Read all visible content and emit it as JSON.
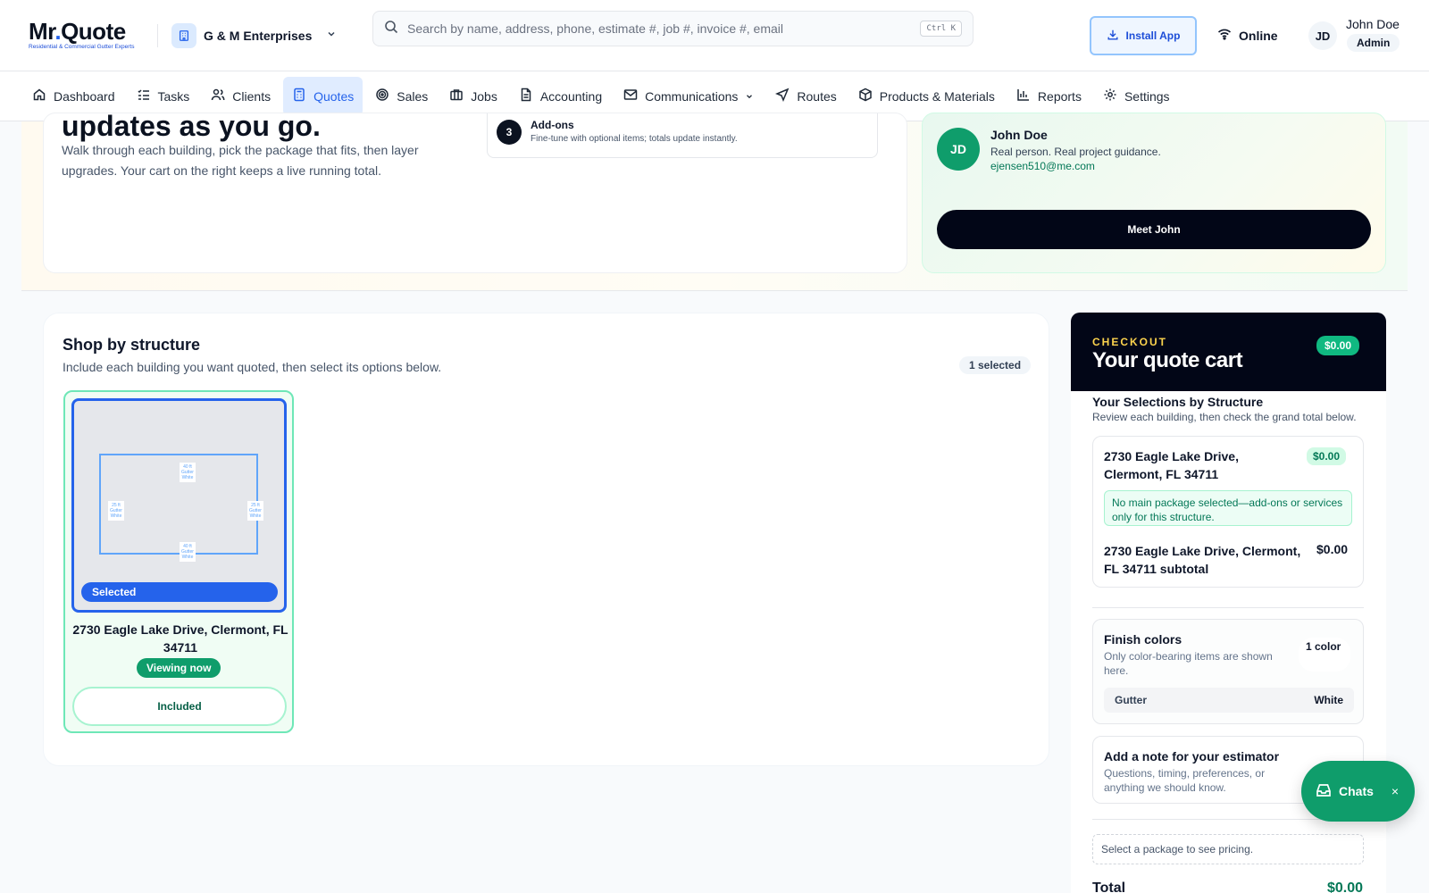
{
  "brand": {
    "name": "Mr.Quote",
    "name_main": "Mr",
    "name_dot": ".",
    "name_rest": "Quote",
    "tagline": "Residential & Commercial Gutter Experts",
    "accent": "#2563eb"
  },
  "company": {
    "name": "G & M Enterprises"
  },
  "search": {
    "placeholder": "Search by name, address, phone, estimate #, job #, invoice #, email",
    "shortcut": "Ctrl K"
  },
  "header": {
    "install_label": "Install App",
    "status": "Online",
    "user_initials": "JD",
    "user_name": "John Doe",
    "user_role": "Admin"
  },
  "nav": [
    {
      "label": "Dashboard",
      "icon": "home-icon"
    },
    {
      "label": "Tasks",
      "icon": "list-icon"
    },
    {
      "label": "Clients",
      "icon": "users-icon"
    },
    {
      "label": "Quotes",
      "icon": "calculator-icon",
      "active": true
    },
    {
      "label": "Sales",
      "icon": "target-icon"
    },
    {
      "label": "Jobs",
      "icon": "briefcase-icon"
    },
    {
      "label": "Accounting",
      "icon": "file-icon"
    },
    {
      "label": "Communications",
      "icon": "mail-icon",
      "has_dropdown": true
    },
    {
      "label": "Routes",
      "icon": "navigation-icon"
    },
    {
      "label": "Products & Materials",
      "icon": "box-icon"
    },
    {
      "label": "Reports",
      "icon": "bar-chart-icon"
    },
    {
      "label": "Settings",
      "icon": "gear-icon"
    }
  ],
  "hero": {
    "title_partial": "updates as you go.",
    "description": "Walk through each building, pick the package that fits, then layer upgrades. Your cart on the right keeps a live running total.",
    "step": {
      "number": "3",
      "title": "Add-ons",
      "description": "Fine-tune with optional items; totals update instantly."
    }
  },
  "rep": {
    "initials": "JD",
    "name": "John Doe",
    "tagline": "Real person. Real project guidance.",
    "email": "ejensen510@me.com",
    "button_label": "Meet John"
  },
  "shop": {
    "title": "Shop by structure",
    "subtitle": "Include each building you want quoted, then select its options below.",
    "selected_count": "1 selected",
    "structures": [
      {
        "address": "2730 Eagle Lake Drive, Clermont, FL 34711",
        "selected_label": "Selected",
        "viewing_label": "Viewing now",
        "included_label": "Included",
        "segments": [
          {
            "length": "40 ft",
            "type": "Gutter",
            "color": "White"
          },
          {
            "length": "25 ft",
            "type": "Gutter",
            "color": "White"
          },
          {
            "length": "25 ft",
            "type": "Gutter",
            "color": "White"
          },
          {
            "length": "40 ft",
            "type": "Gutter",
            "color": "White"
          }
        ]
      }
    ]
  },
  "cart": {
    "kicker": "CHECKOUT",
    "title": "Your quote cart",
    "total_badge": "$0.00",
    "selections_title": "Your Selections by Structure",
    "selections_subtitle": "Review each building, then check the grand total below.",
    "structure": {
      "address": "2730 Eagle Lake Drive, Clermont, FL 34711",
      "price": "$0.00",
      "note": "No main package selected—add-ons or services only for this structure.",
      "subtotal_label": "2730 Eagle Lake Drive, Clermont, FL 34711 subtotal",
      "subtotal_value": "$0.00"
    },
    "finish_colors": {
      "title": "Finish colors",
      "subtitle": "Only color-bearing items are shown here.",
      "count": "1 color",
      "rows": [
        {
          "item": "Gutter",
          "color": "White"
        }
      ]
    },
    "note": {
      "title": "Add a note for your estimator",
      "subtitle": "Questions, timing, preferences, or anything we should know."
    },
    "pricing_hint": "Select a package to see pricing.",
    "total_label": "Total",
    "total_value": "$0.00"
  },
  "chat": {
    "label": "Chats",
    "close": "×"
  },
  "colors": {
    "primary": "#2563eb",
    "success": "#0f9d6b",
    "dark": "#020617",
    "gold": "#fcd34d"
  }
}
